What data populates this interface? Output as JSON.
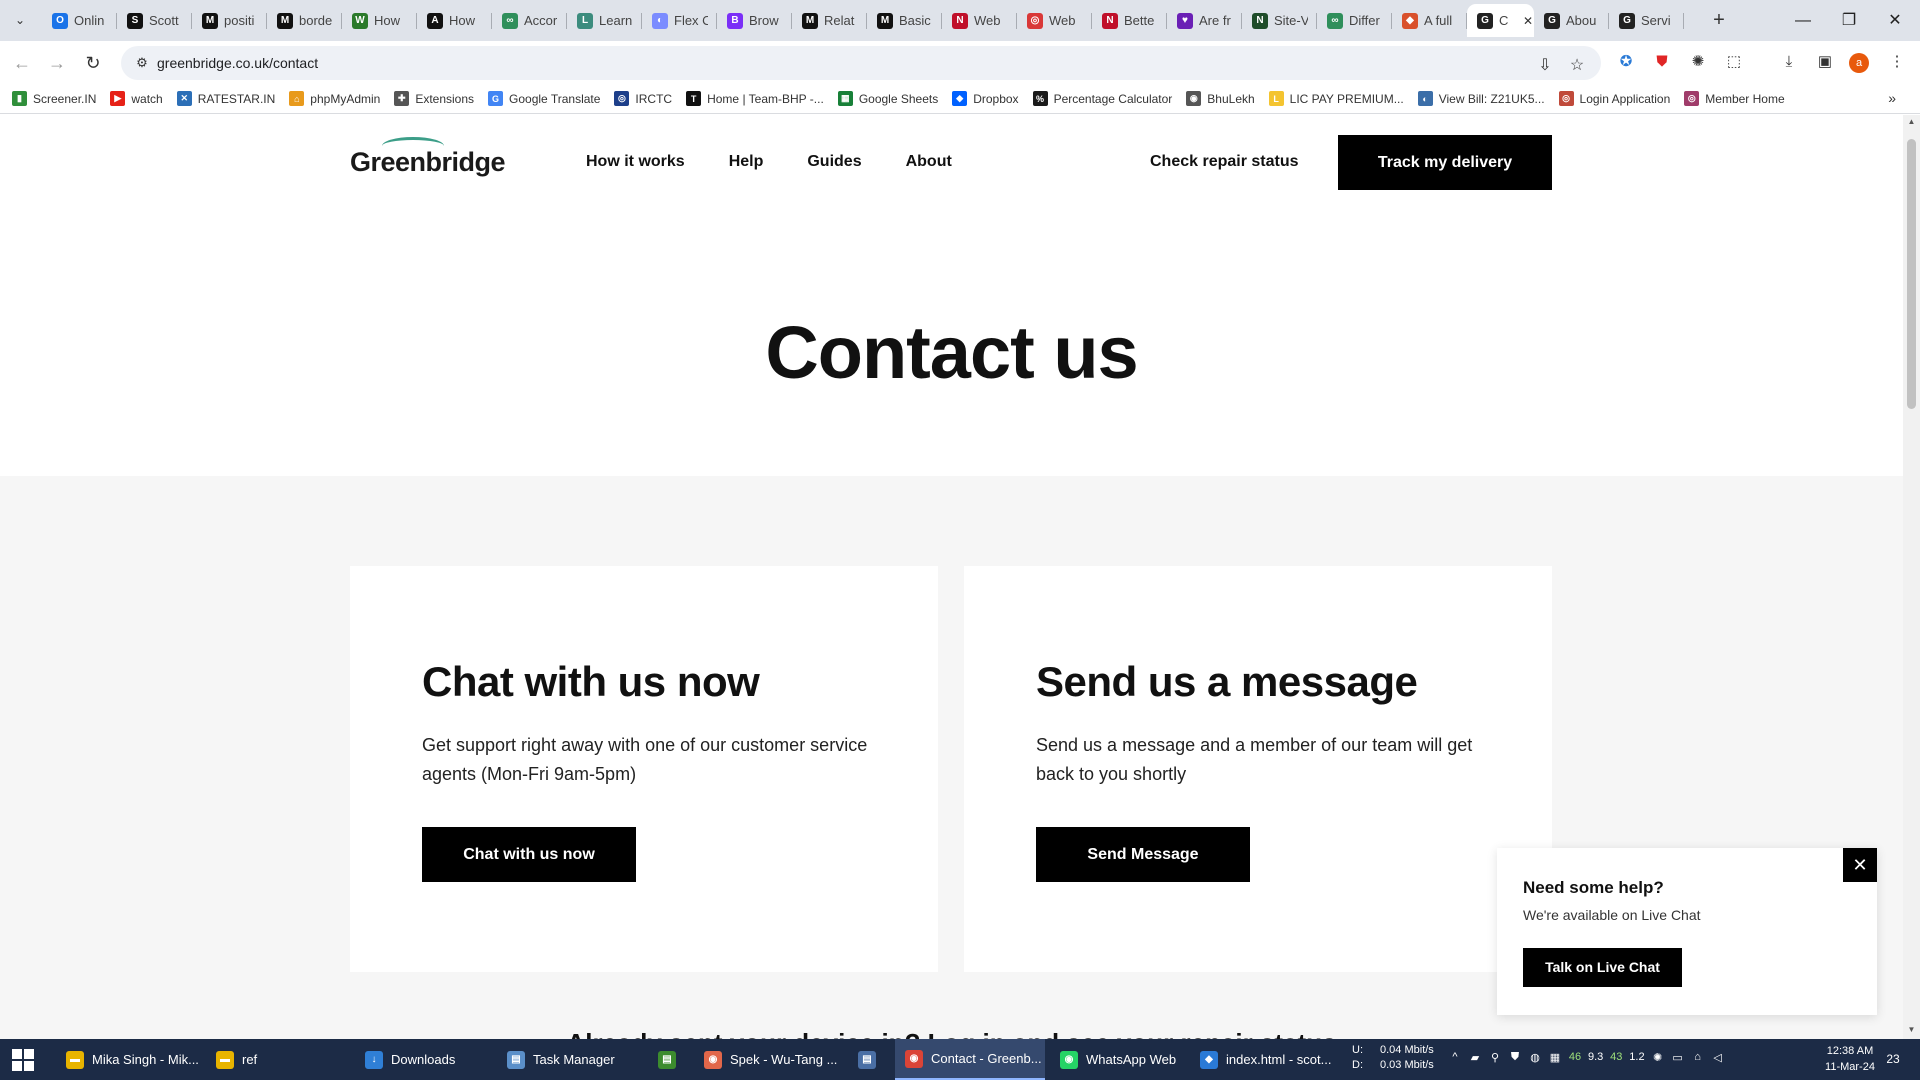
{
  "browser": {
    "tabs": [
      {
        "label": "Onlin",
        "icon": "O",
        "color": "#1a73e8"
      },
      {
        "label": "Scott",
        "icon": "S",
        "color": "#111111"
      },
      {
        "label": "positi",
        "icon": "M",
        "color": "#111111"
      },
      {
        "label": "borde",
        "icon": "M",
        "color": "#111111"
      },
      {
        "label": "How",
        "icon": "W",
        "color": "#2b7a2b"
      },
      {
        "label": "How",
        "icon": "A",
        "color": "#111111"
      },
      {
        "label": "Accor",
        "icon": "∞",
        "color": "#2f8f5b"
      },
      {
        "label": "Learn",
        "icon": "L",
        "color": "#3c8c7e"
      },
      {
        "label": "Flex C",
        "icon": "◐",
        "color": "#7b8cff"
      },
      {
        "label": "Brow",
        "icon": "B",
        "color": "#7b2ff7"
      },
      {
        "label": "Relat",
        "icon": "M",
        "color": "#111111"
      },
      {
        "label": "Basic",
        "icon": "M",
        "color": "#111111"
      },
      {
        "label": "Web",
        "icon": "N",
        "color": "#c0102a"
      },
      {
        "label": "Web",
        "icon": "◎",
        "color": "#d93838"
      },
      {
        "label": "Bette",
        "icon": "N",
        "color": "#c0102a"
      },
      {
        "label": "Are fr",
        "icon": "♥",
        "color": "#6a1fb5"
      },
      {
        "label": "Site-V",
        "icon": "N",
        "color": "#1f4d2a"
      },
      {
        "label": "Differ",
        "icon": "∞",
        "color": "#2f8f5b"
      },
      {
        "label": "A full",
        "icon": "◆",
        "color": "#d9512c"
      },
      {
        "label": "C",
        "icon": "G",
        "color": "#222222",
        "active": true
      },
      {
        "label": "Abou",
        "icon": "G",
        "color": "#222222"
      },
      {
        "label": "Servi",
        "icon": "G",
        "color": "#222222"
      }
    ],
    "url": "greenbridge.co.uk/contact",
    "profile_initial": "a"
  },
  "bookmarks": [
    {
      "label": "Screener.IN",
      "icon": "▮",
      "color": "#2f8f3a"
    },
    {
      "label": "watch",
      "icon": "▶",
      "color": "#e62117"
    },
    {
      "label": "RATESTAR.IN",
      "icon": "✕",
      "color": "#2c6fb7"
    },
    {
      "label": "phpMyAdmin",
      "icon": "⌂",
      "color": "#e89a1c"
    },
    {
      "label": "Extensions",
      "icon": "✚",
      "color": "#555555"
    },
    {
      "label": "Google Translate",
      "icon": "G",
      "color": "#4285f4"
    },
    {
      "label": "IRCTC",
      "icon": "◎",
      "color": "#1d3f8a"
    },
    {
      "label": "Home | Team-BHP -...",
      "icon": "T",
      "color": "#111111"
    },
    {
      "label": "Google Sheets",
      "icon": "▦",
      "color": "#188038"
    },
    {
      "label": "Dropbox",
      "icon": "◆",
      "color": "#0061ff"
    },
    {
      "label": "Percentage Calculator",
      "icon": "%",
      "color": "#1a1a1a"
    },
    {
      "label": "BhuLekh",
      "icon": "◉",
      "color": "#555555"
    },
    {
      "label": "LIC PAY PREMIUM...",
      "icon": "L",
      "color": "#f4c430"
    },
    {
      "label": "View Bill: Z21UK5...",
      "icon": "◐",
      "color": "#3b6ea8"
    },
    {
      "label": "Login Application",
      "icon": "◎",
      "color": "#c04a3a"
    },
    {
      "label": "Member Home",
      "icon": "◎",
      "color": "#a03c6a"
    }
  ],
  "site": {
    "logo": "Greenbridge",
    "nav": [
      "How it works",
      "Help",
      "Guides",
      "About"
    ],
    "repair_link": "Check repair status",
    "track_button": "Track my delivery",
    "hero_title": "Contact us",
    "cards": [
      {
        "title": "Chat with us now",
        "text": "Get support right away with one of our customer service agents (Mon-Fri 9am-5pm)",
        "button": "Chat with us now"
      },
      {
        "title": "Send us a message",
        "text": "Send us a message and a member of our team will get back to you shortly",
        "button": "Send Message"
      }
    ],
    "below_text": "Already sent your device in? Log in and see your repair status",
    "help_popup": {
      "title": "Need some help?",
      "subtitle": "We're available on Live Chat",
      "button": "Talk on Live Chat",
      "close": "✕"
    }
  },
  "taskbar": {
    "items": [
      {
        "label": "Mika Singh - Mik...",
        "icon": "▬",
        "color": "#e8b400"
      },
      {
        "label": "ref",
        "icon": "▬",
        "color": "#e8b400"
      },
      {
        "label": "Downloads",
        "icon": "↓",
        "color": "#2f7fd6"
      },
      {
        "label": "Task Manager",
        "icon": "▤",
        "color": "#5a8fc9"
      },
      {
        "label": "",
        "icon": "▤",
        "color": "#3c8c2e"
      },
      {
        "label": "Spek - Wu-Tang ...",
        "icon": "◉",
        "color": "#e2674a"
      },
      {
        "label": "",
        "icon": "▤",
        "color": "#4a6fa5"
      },
      {
        "label": "Contact - Greenb...",
        "icon": "◉",
        "color": "#db4437",
        "active": true
      },
      {
        "label": "WhatsApp Web",
        "icon": "◉",
        "color": "#25d366"
      },
      {
        "label": "index.html - scot...",
        "icon": "◆",
        "color": "#2a7ad6"
      }
    ],
    "network": {
      "up_label": "U:",
      "up": "0.04 Mbit/s",
      "down_label": "D:",
      "down": "0.03 Mbit/s"
    },
    "tray": [
      "^",
      "46",
      "9.3",
      "43",
      "1.2"
    ],
    "time": "12:38 AM",
    "date": "11-Mar-24",
    "notifications": "23"
  }
}
